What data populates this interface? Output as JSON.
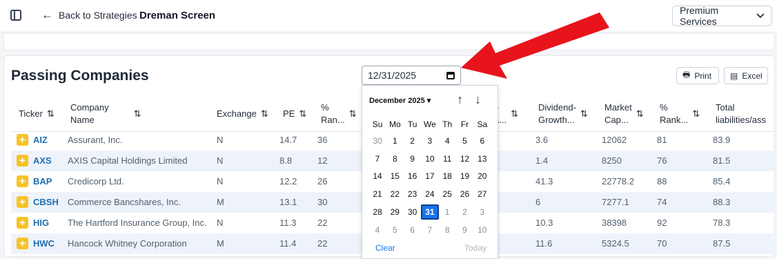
{
  "header": {
    "back_label": "Back to Strategies",
    "title": "Dreman Screen",
    "premium_label": "Premium Services"
  },
  "section": {
    "title": "Passing Companies"
  },
  "date_input": {
    "value": "12/31/2025"
  },
  "buttons": {
    "print": "Print",
    "excel": "Excel"
  },
  "columns": [
    {
      "label": "Ticker",
      "sub": ""
    },
    {
      "label": "Company",
      "sub": "Name"
    },
    {
      "label": "Exchange",
      "sub": ""
    },
    {
      "label": "PE",
      "sub": ""
    },
    {
      "label": "%",
      "sub": "Ran..."
    },
    {
      "label": "l-",
      "sub": "a..."
    },
    {
      "label": "Dividend-",
      "sub": "Growth..."
    },
    {
      "label": "Market",
      "sub": "Cap..."
    },
    {
      "label": "%",
      "sub": "Rank..."
    },
    {
      "label": "Total",
      "sub": "liabilities/ass"
    }
  ],
  "rows": [
    {
      "ticker": "AIZ",
      "company": "Assurant, Inc.",
      "exchange": "N",
      "pe": "14.7",
      "rank": "36",
      "dividend_growth": "3.6",
      "market_cap": "12062",
      "rank2": "81",
      "liabilities": "83.9"
    },
    {
      "ticker": "AXS",
      "company": "AXIS Capital Holdings Limited",
      "exchange": "N",
      "pe": "8.8",
      "rank": "12",
      "dividend_growth": "1.4",
      "market_cap": "8250",
      "rank2": "76",
      "liabilities": "81.5"
    },
    {
      "ticker": "BAP",
      "company": "Credicorp Ltd.",
      "exchange": "N",
      "pe": "12.2",
      "rank": "26",
      "dividend_growth": "41.3",
      "market_cap": "22778.2",
      "rank2": "88",
      "liabilities": "85.4"
    },
    {
      "ticker": "CBSH",
      "company": "Commerce Bancshares, Inc.",
      "exchange": "M",
      "pe": "13.1",
      "rank": "30",
      "dividend_growth": "6",
      "market_cap": "7277.1",
      "rank2": "74",
      "liabilities": "88.3"
    },
    {
      "ticker": "HIG",
      "company": "The Hartford Insurance Group, Inc.",
      "exchange": "N",
      "pe": "11.3",
      "rank": "22",
      "dividend_growth": "10.3",
      "market_cap": "38398",
      "rank2": "92",
      "liabilities": "78.3"
    },
    {
      "ticker": "HWC",
      "company": "Hancock Whitney Corporation",
      "exchange": "M",
      "pe": "11.4",
      "rank": "22",
      "dividend_growth": "11.6",
      "market_cap": "5324.5",
      "rank2": "70",
      "liabilities": "87.5"
    }
  ],
  "datepicker": {
    "month_label": "December 2025 ▾",
    "weekdays": [
      "Su",
      "Mo",
      "Tu",
      "We",
      "Th",
      "Fr",
      "Sa"
    ],
    "weeks": [
      [
        "30",
        "1",
        "2",
        "3",
        "4",
        "5",
        "6"
      ],
      [
        "7",
        "8",
        "9",
        "10",
        "11",
        "12",
        "13"
      ],
      [
        "14",
        "15",
        "16",
        "17",
        "18",
        "19",
        "20"
      ],
      [
        "21",
        "22",
        "23",
        "24",
        "25",
        "26",
        "27"
      ],
      [
        "28",
        "29",
        "30",
        "31",
        "1",
        "2",
        "3"
      ],
      [
        "4",
        "5",
        "6",
        "7",
        "8",
        "9",
        "10"
      ]
    ],
    "selected": "31",
    "clear_label": "Clear",
    "today_label": "Today"
  },
  "colors": {
    "accent": "#1a73e8",
    "ticker": "#1f6fb2",
    "plus": "#f7c325",
    "arrow": "#e8141b",
    "row_alt": "#eef3fb"
  },
  "icons": {
    "sidebar": "sidebar-toggle-icon",
    "back": "arrow-left-icon",
    "dropdown": "chevron-down-icon",
    "calendar": "calendar-icon",
    "print": "printer-icon",
    "excel": "spreadsheet-icon",
    "sort": "sort-icon",
    "plus": "plus-icon",
    "annotation": "red-arrow-icon"
  }
}
